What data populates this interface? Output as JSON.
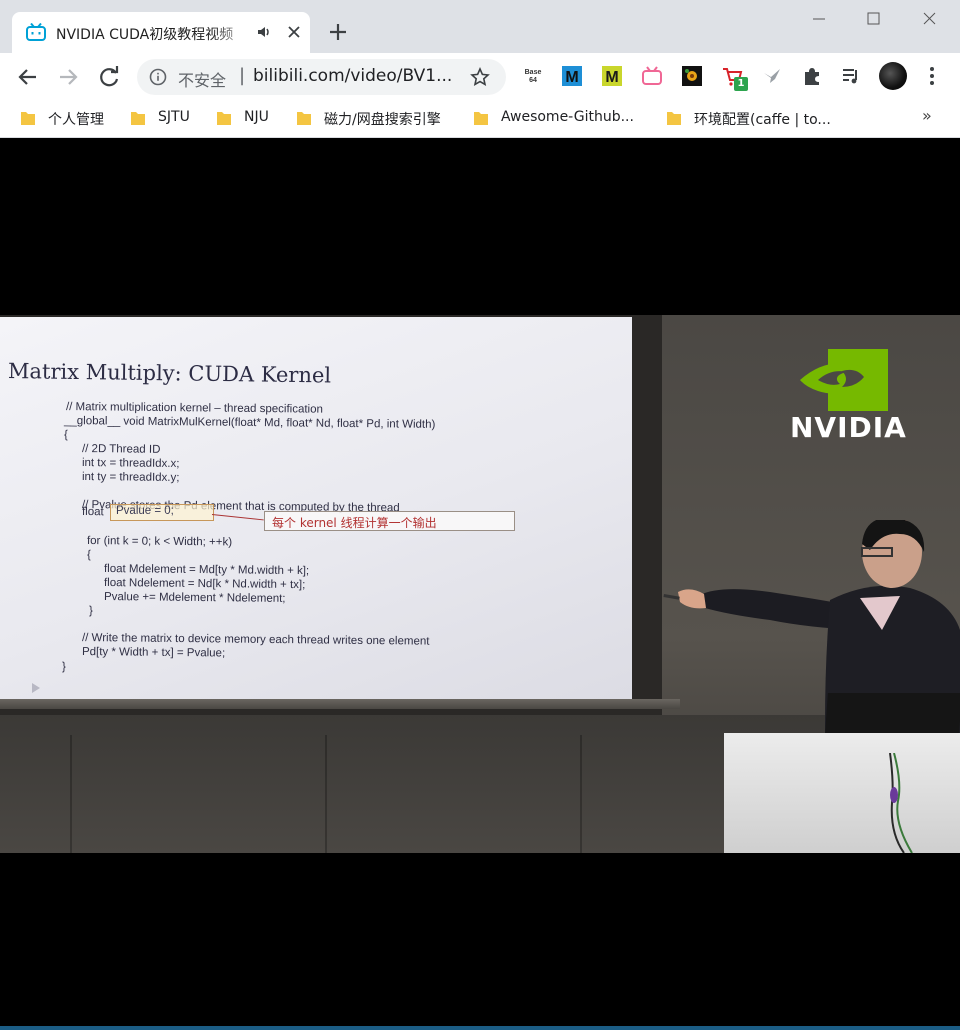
{
  "browser": {
    "tab": {
      "title": "NVIDIA CUDA初级教程视频",
      "favicon": "bilibili-tv-icon"
    },
    "new_tab": "+",
    "window_controls": [
      "minimize",
      "maximize",
      "close"
    ],
    "omnibox": {
      "security_label": "不安全",
      "separator": "|",
      "url": "bilibili.com/video/BV1..."
    },
    "extensions": [
      {
        "name": "base64-icon",
        "label": "Base 64"
      },
      {
        "name": "m-blue-icon",
        "label": "M"
      },
      {
        "name": "m-yellow-icon",
        "label": "M"
      },
      {
        "name": "bilibili-tv-icon"
      },
      {
        "name": "flower-icon"
      },
      {
        "name": "cart-icon",
        "badge": "1"
      },
      {
        "name": "bird-icon"
      },
      {
        "name": "puzzle-icon"
      },
      {
        "name": "media-queue-icon"
      }
    ],
    "bookmarks": [
      {
        "label": "个人管理"
      },
      {
        "label": "SJTU"
      },
      {
        "label": "NJU"
      },
      {
        "label": "磁力/网盘搜索引擎"
      },
      {
        "label": "Awesome-Github..."
      },
      {
        "label": "环境配置(caffe | to..."
      }
    ],
    "bookmarks_overflow": "»"
  },
  "video": {
    "slide": {
      "title": "Matrix Multiply:  CUDA Kernel",
      "code_lines": [
        "// Matrix multiplication kernel – thread specification",
        "__global__ void MatrixMulKernel(float* Md, float* Nd, float* Pd, int Width)",
        "{",
        "// 2D Thread ID",
        "int tx = threadIdx.x;",
        "int ty = threadIdx.y;",
        "// Pvalue stores the Pd element that is computed by the thread",
        "float",
        "for (int k = 0; k < Width; ++k)",
        "{",
        "float Mdelement = Md[ty * Md.width + k];",
        "float Ndelement = Nd[k * Nd.width + tx];",
        "Pvalue += Mdelement * Ndelement;",
        "}",
        "// Write the matrix to device memory each thread writes one element",
        "Pd[ty * Width + tx] = Pvalue;",
        "}"
      ],
      "highlight": "Pvalue = 0;",
      "callout": "每个 kernel 线程计算一个输出"
    },
    "logo_text": "NVIDIA",
    "colors": {
      "nvidia_green": "#76b900",
      "callout_red": "#b23232"
    }
  }
}
